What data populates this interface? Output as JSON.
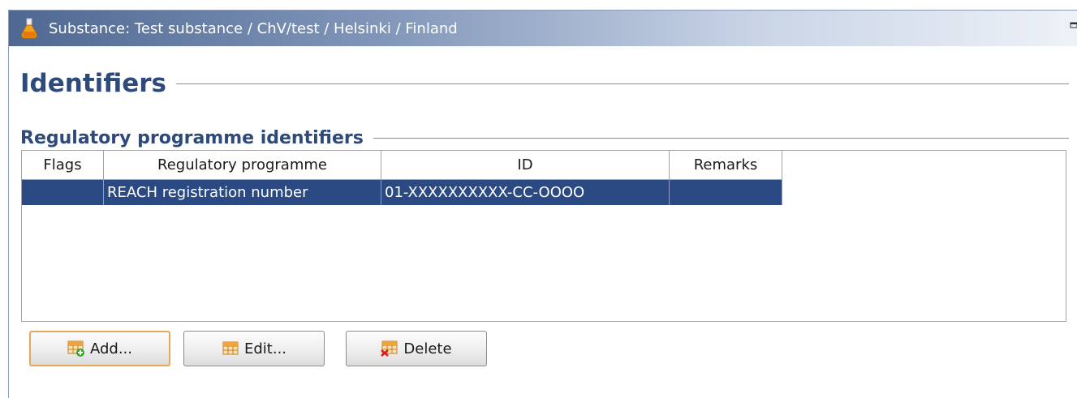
{
  "window": {
    "title": "Substance: Test substance / ChV/test / Helsinki / Finland",
    "title_icon": "flask-icon"
  },
  "page": {
    "heading": "Identifiers",
    "subheading": "Regulatory programme identifiers"
  },
  "table": {
    "columns": [
      "Flags",
      "Regulatory programme",
      "ID",
      "Remarks"
    ],
    "rows": [
      {
        "flags": "",
        "programme": "REACH registration number",
        "id": "01-XXXXXXXXXX-CC-OOOO",
        "remarks": "",
        "selected": true
      }
    ]
  },
  "buttons": {
    "add": "Add...",
    "edit": "Edit...",
    "delete": "Delete"
  },
  "colors": {
    "heading": "#2e4a7b",
    "selection": "#2b4a83",
    "focus_border": "#e5a85b"
  }
}
